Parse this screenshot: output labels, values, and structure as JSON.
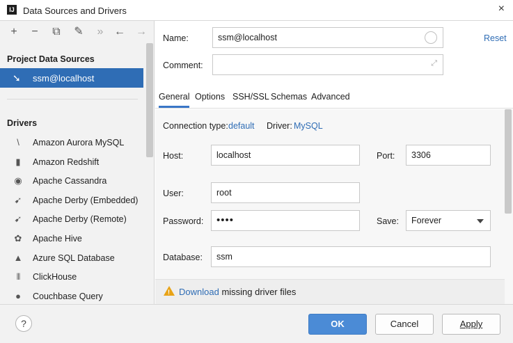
{
  "window": {
    "title": "Data Sources and Drivers",
    "app_icon": "ij-icon",
    "close": "×"
  },
  "toolbar": {
    "items": [
      {
        "name": "add-button",
        "glyph": "+"
      },
      {
        "name": "remove-button",
        "glyph": "−"
      },
      {
        "name": "duplicate-button",
        "glyph": "⧉"
      },
      {
        "name": "settings-button",
        "glyph": "✎"
      },
      {
        "name": "more-button",
        "glyph": "»"
      },
      {
        "name": "back-button",
        "glyph": "←"
      },
      {
        "name": "forward-button",
        "glyph": "→"
      }
    ]
  },
  "sidebar": {
    "project_header": "Project Data Sources",
    "project_items": [
      {
        "label": "ssm@localhost",
        "selected": true
      }
    ],
    "drivers_header": "Drivers",
    "drivers": [
      {
        "label": "Amazon Aurora MySQL",
        "icon": "aurora-icon",
        "glyph": "\\"
      },
      {
        "label": "Amazon Redshift",
        "icon": "redshift-icon",
        "glyph": "▮"
      },
      {
        "label": "Apache Cassandra",
        "icon": "cassandra-icon",
        "glyph": "◉"
      },
      {
        "label": "Apache Derby (Embedded)",
        "icon": "derby-icon",
        "glyph": "➹"
      },
      {
        "label": "Apache Derby (Remote)",
        "icon": "derby-icon",
        "glyph": "➹"
      },
      {
        "label": "Apache Hive",
        "icon": "hive-icon",
        "glyph": "✿"
      },
      {
        "label": "Azure SQL Database",
        "icon": "azure-icon",
        "glyph": "▲"
      },
      {
        "label": "ClickHouse",
        "icon": "clickhouse-icon",
        "glyph": "|||"
      },
      {
        "label": "Couchbase Query",
        "icon": "couchbase-icon",
        "glyph": "●"
      }
    ]
  },
  "form": {
    "name_label": "Name:",
    "name_value": "ssm@localhost",
    "reset": "Reset",
    "comment_label": "Comment:",
    "comment_value": "",
    "tabs": [
      {
        "label": "General",
        "active": true
      },
      {
        "label": "Options",
        "active": false
      },
      {
        "label": "SSH/SSL",
        "active": false
      },
      {
        "label": "Schemas",
        "active": false
      },
      {
        "label": "Advanced",
        "active": false
      }
    ],
    "connection_type_label": "Connection type:",
    "connection_type_value": "default",
    "driver_label": "Driver:",
    "driver_value": "MySQL",
    "host_label": "Host:",
    "host_value": "localhost",
    "port_label": "Port:",
    "port_value": "3306",
    "user_label": "User:",
    "user_value": "root",
    "password_label": "Password:",
    "password_value": "••••",
    "save_label": "Save:",
    "save_value": "Forever",
    "database_label": "Database:",
    "database_value": "ssm"
  },
  "warning": {
    "link": "Download",
    "text": " missing driver files"
  },
  "buttons": {
    "help": "?",
    "ok": "OK",
    "cancel": "Cancel",
    "apply": "Apply"
  },
  "colors": {
    "accent": "#2f6db5",
    "primary_button": "#4b8bd6",
    "warning": "#e8a317"
  }
}
